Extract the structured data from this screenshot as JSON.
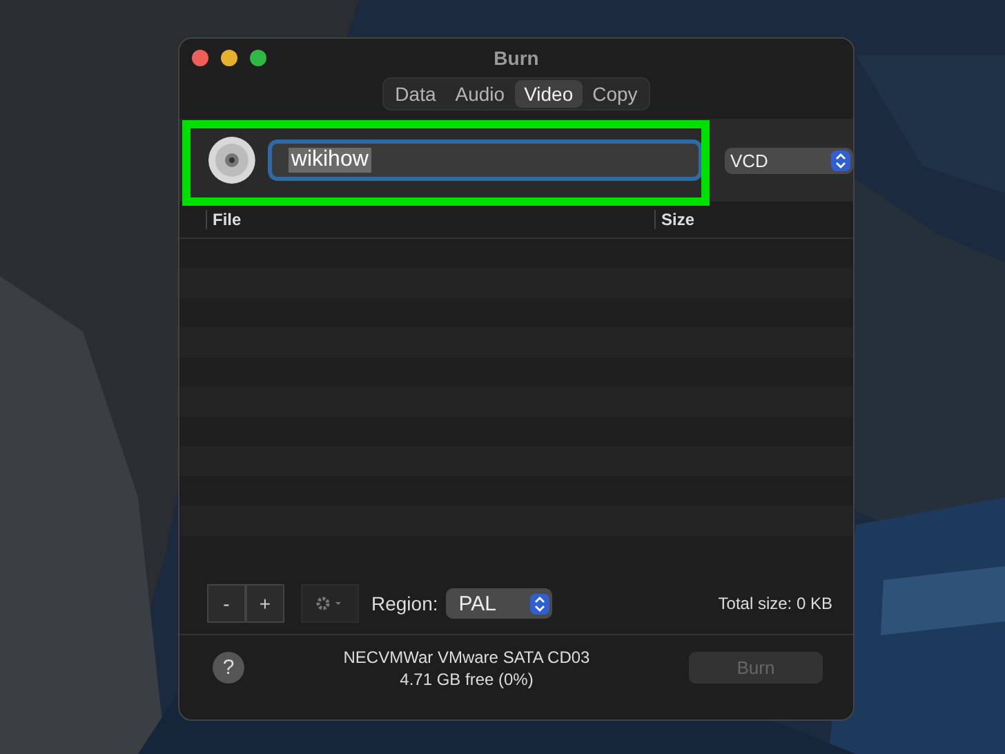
{
  "window": {
    "title": "Burn"
  },
  "tabs": [
    {
      "label": "Data",
      "selected": false
    },
    {
      "label": "Audio",
      "selected": false
    },
    {
      "label": "Video",
      "selected": true
    },
    {
      "label": "Copy",
      "selected": false
    }
  ],
  "disc": {
    "name": "wikihow",
    "name_selected": true,
    "format": "VCD",
    "highlighted": true
  },
  "table": {
    "columns": [
      "File",
      "Size"
    ]
  },
  "toolbar": {
    "remove": "-",
    "add": "+",
    "region_label": "Region:",
    "region": "PAL",
    "total_size": "Total size: 0 KB"
  },
  "footer": {
    "help": "?",
    "device": "NECVMWar VMware SATA CD03",
    "free": "4.71 GB free (0%)",
    "burn": {
      "label": "Burn",
      "disabled": true
    }
  }
}
